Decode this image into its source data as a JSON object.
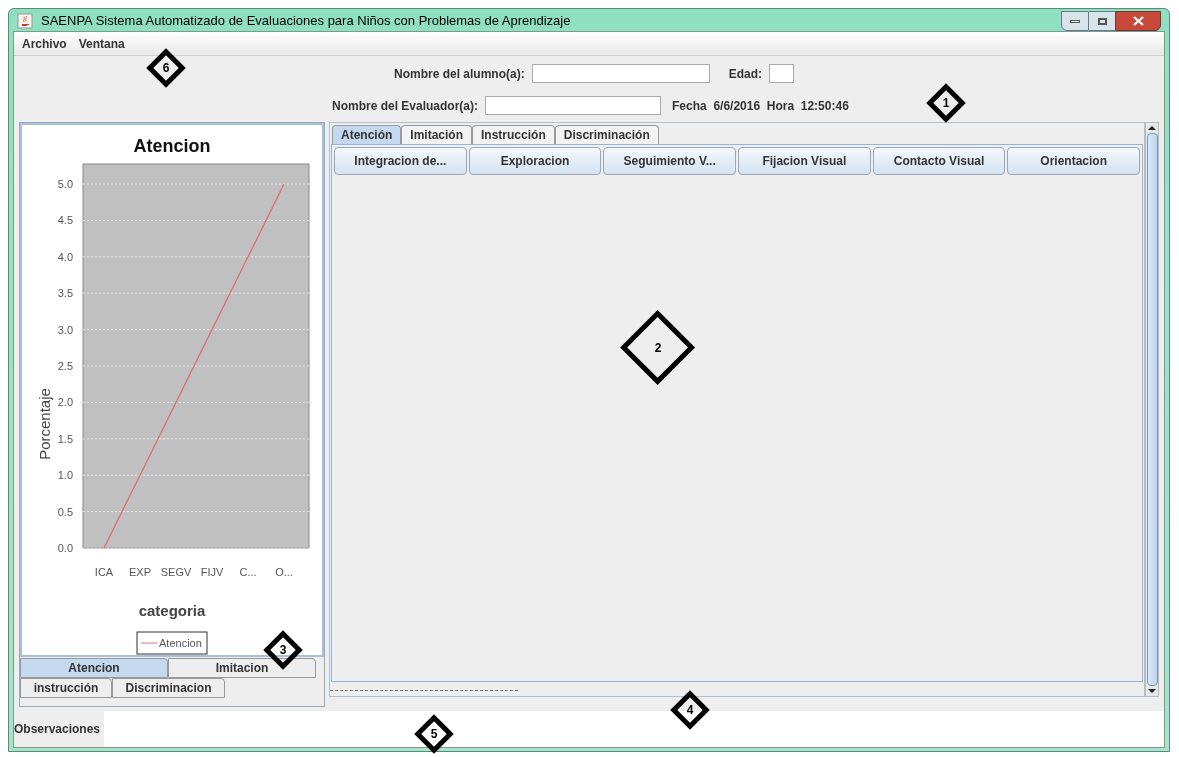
{
  "window": {
    "title": "SAENPA Sistema Automatizado de Evaluaciones para Niños con Problemas de Aprendizaje"
  },
  "menu": [
    "Archivo",
    "Ventana"
  ],
  "form": {
    "student_label": "Nombre del alumno(a):",
    "age_label": "Edad:",
    "evaluator_label": "Nombre del Evaluador(a):",
    "date_label": "Fecha",
    "date": "6/6/2016",
    "time_label": "Hora",
    "time": "12:50:46"
  },
  "chart_panel": {
    "chart_data": {
      "type": "line",
      "grid": true,
      "title": "Atencion",
      "xlabel": "categoria",
      "ylabel": "Porcentaje",
      "categories": [
        "ICA",
        "EXP",
        "SEGV",
        "FIJV",
        "C...",
        "O..."
      ],
      "series": [
        {
          "name": "Atencion",
          "color": "#e07070",
          "values": [
            0,
            1,
            2,
            3,
            4,
            5
          ]
        }
      ],
      "ylim": [
        0,
        5
      ],
      "yticks": [
        {
          "value": 0,
          "label": "0.0"
        },
        {
          "value": 0.5,
          "label": "0.5"
        },
        {
          "value": 1,
          "label": "1.0"
        },
        {
          "value": 1.5,
          "label": "1.5"
        },
        {
          "value": 2,
          "label": "2.0"
        },
        {
          "value": 2.5,
          "label": "2.5"
        },
        {
          "value": 3,
          "label": "3.0"
        },
        {
          "value": 3.5,
          "label": "3.5"
        },
        {
          "value": 4,
          "label": "4.0"
        },
        {
          "value": 4.5,
          "label": "4.5"
        },
        {
          "value": 5,
          "label": "5.0"
        }
      ]
    },
    "tabs": [
      {
        "label": "Atencion",
        "selected": true
      },
      {
        "label": "Imitacion",
        "selected": false
      },
      {
        "label": "instrucción",
        "selected": false
      },
      {
        "label": "Discriminacion",
        "selected": false
      }
    ]
  },
  "main_tabs": [
    {
      "label": "Atención",
      "selected": true
    },
    {
      "label": "Imitación",
      "selected": false
    },
    {
      "label": "Instrucción",
      "selected": false
    },
    {
      "label": "Discriminación",
      "selected": false
    }
  ],
  "sub_buttons": [
    "Integracion de...",
    "Exploracion",
    "Seguimiento V...",
    "Fijacion Visual",
    "Contacto Visual",
    "Orientacion"
  ],
  "observations_label": "Observaciones",
  "callouts": [
    {
      "label": "6",
      "kind": "small"
    },
    {
      "label": "1",
      "kind": "small"
    },
    {
      "label": "2",
      "kind": "large"
    },
    {
      "label": "3",
      "kind": "small"
    },
    {
      "label": "4",
      "kind": "small"
    },
    {
      "label": "5",
      "kind": "small"
    }
  ]
}
